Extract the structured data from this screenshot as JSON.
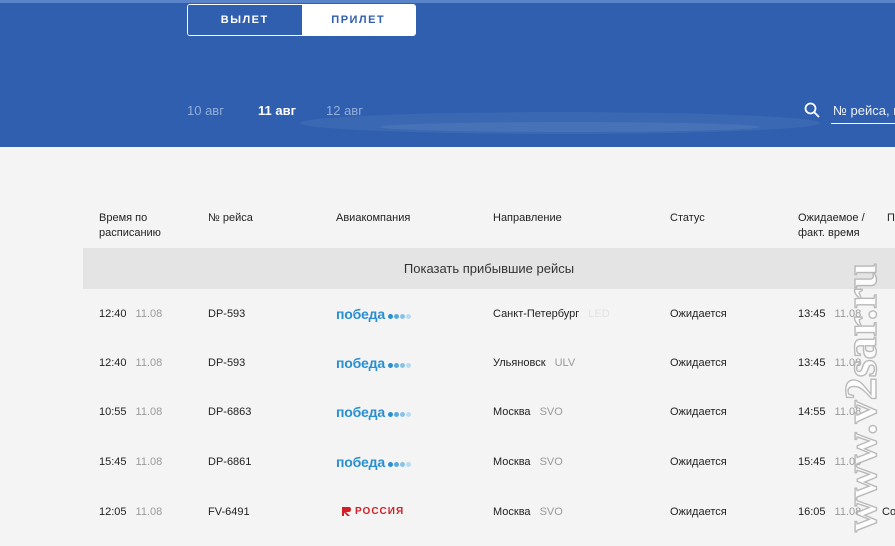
{
  "header": {
    "toggle": {
      "departure": "ВЫЛЕТ",
      "arrival": "ПРИЛЕТ",
      "selected": "arrival"
    },
    "dates": [
      {
        "label": "10 авг",
        "active": false
      },
      {
        "label": "11 авг",
        "active": true
      },
      {
        "label": "12 авг",
        "active": false
      }
    ],
    "search": {
      "placeholder": "№ рейса, г"
    },
    "colors": {
      "background": "#2f5fae",
      "active_tab": "#ffffff"
    }
  },
  "table": {
    "columns": [
      "Время по\nрасписанию",
      "№ рейса",
      "Авиакомпания",
      "Направление",
      "Статус",
      "Ожидаемое /\nфакт. время",
      "П"
    ],
    "show_arrived_label": "Показать прибывшие рейсы",
    "rows": [
      {
        "time": "12:40",
        "date": "11.08",
        "flight": "DP-593",
        "airline": "победа",
        "airline_logo": "pobeda",
        "city": "Санкт-Петербург",
        "code": "LED",
        "status": "Ожидается",
        "actual_time": "13:45",
        "actual_date": "11.08",
        "extra": ""
      },
      {
        "time": "12:40",
        "date": "11.08",
        "flight": "DP-593",
        "airline": "победа",
        "airline_logo": "pobeda",
        "city": "Ульяновск",
        "code": "ULV",
        "status": "Ожидается",
        "actual_time": "13:45",
        "actual_date": "11.08",
        "extra": ""
      },
      {
        "time": "10:55",
        "date": "11.08",
        "flight": "DP-6863",
        "airline": "победа",
        "airline_logo": "pobeda",
        "city": "Москва",
        "code": "SVO",
        "status": "Ожидается",
        "actual_time": "14:55",
        "actual_date": "11.08",
        "extra": ""
      },
      {
        "time": "15:45",
        "date": "11.08",
        "flight": "DP-6861",
        "airline": "победа",
        "airline_logo": "pobeda",
        "city": "Москва",
        "code": "SVO",
        "status": "Ожидается",
        "actual_time": "15:45",
        "actual_date": "11.08",
        "extra": ""
      },
      {
        "time": "12:05",
        "date": "11.08",
        "flight": "FV-6491",
        "airline": "РОССИЯ",
        "airline_logo": "rossiya",
        "city": "Москва",
        "code": "SVO",
        "status": "Ожидается",
        "actual_time": "16:05",
        "actual_date": "11.08",
        "extra": "Со"
      }
    ]
  },
  "watermark": "www.v2sar.ru",
  "colors": {
    "pobeda_blue": "#2a8fd0",
    "rossiya_red": "#d21f27",
    "page_bg": "#f4f4f4",
    "bar_bg": "#e4e4e4"
  }
}
